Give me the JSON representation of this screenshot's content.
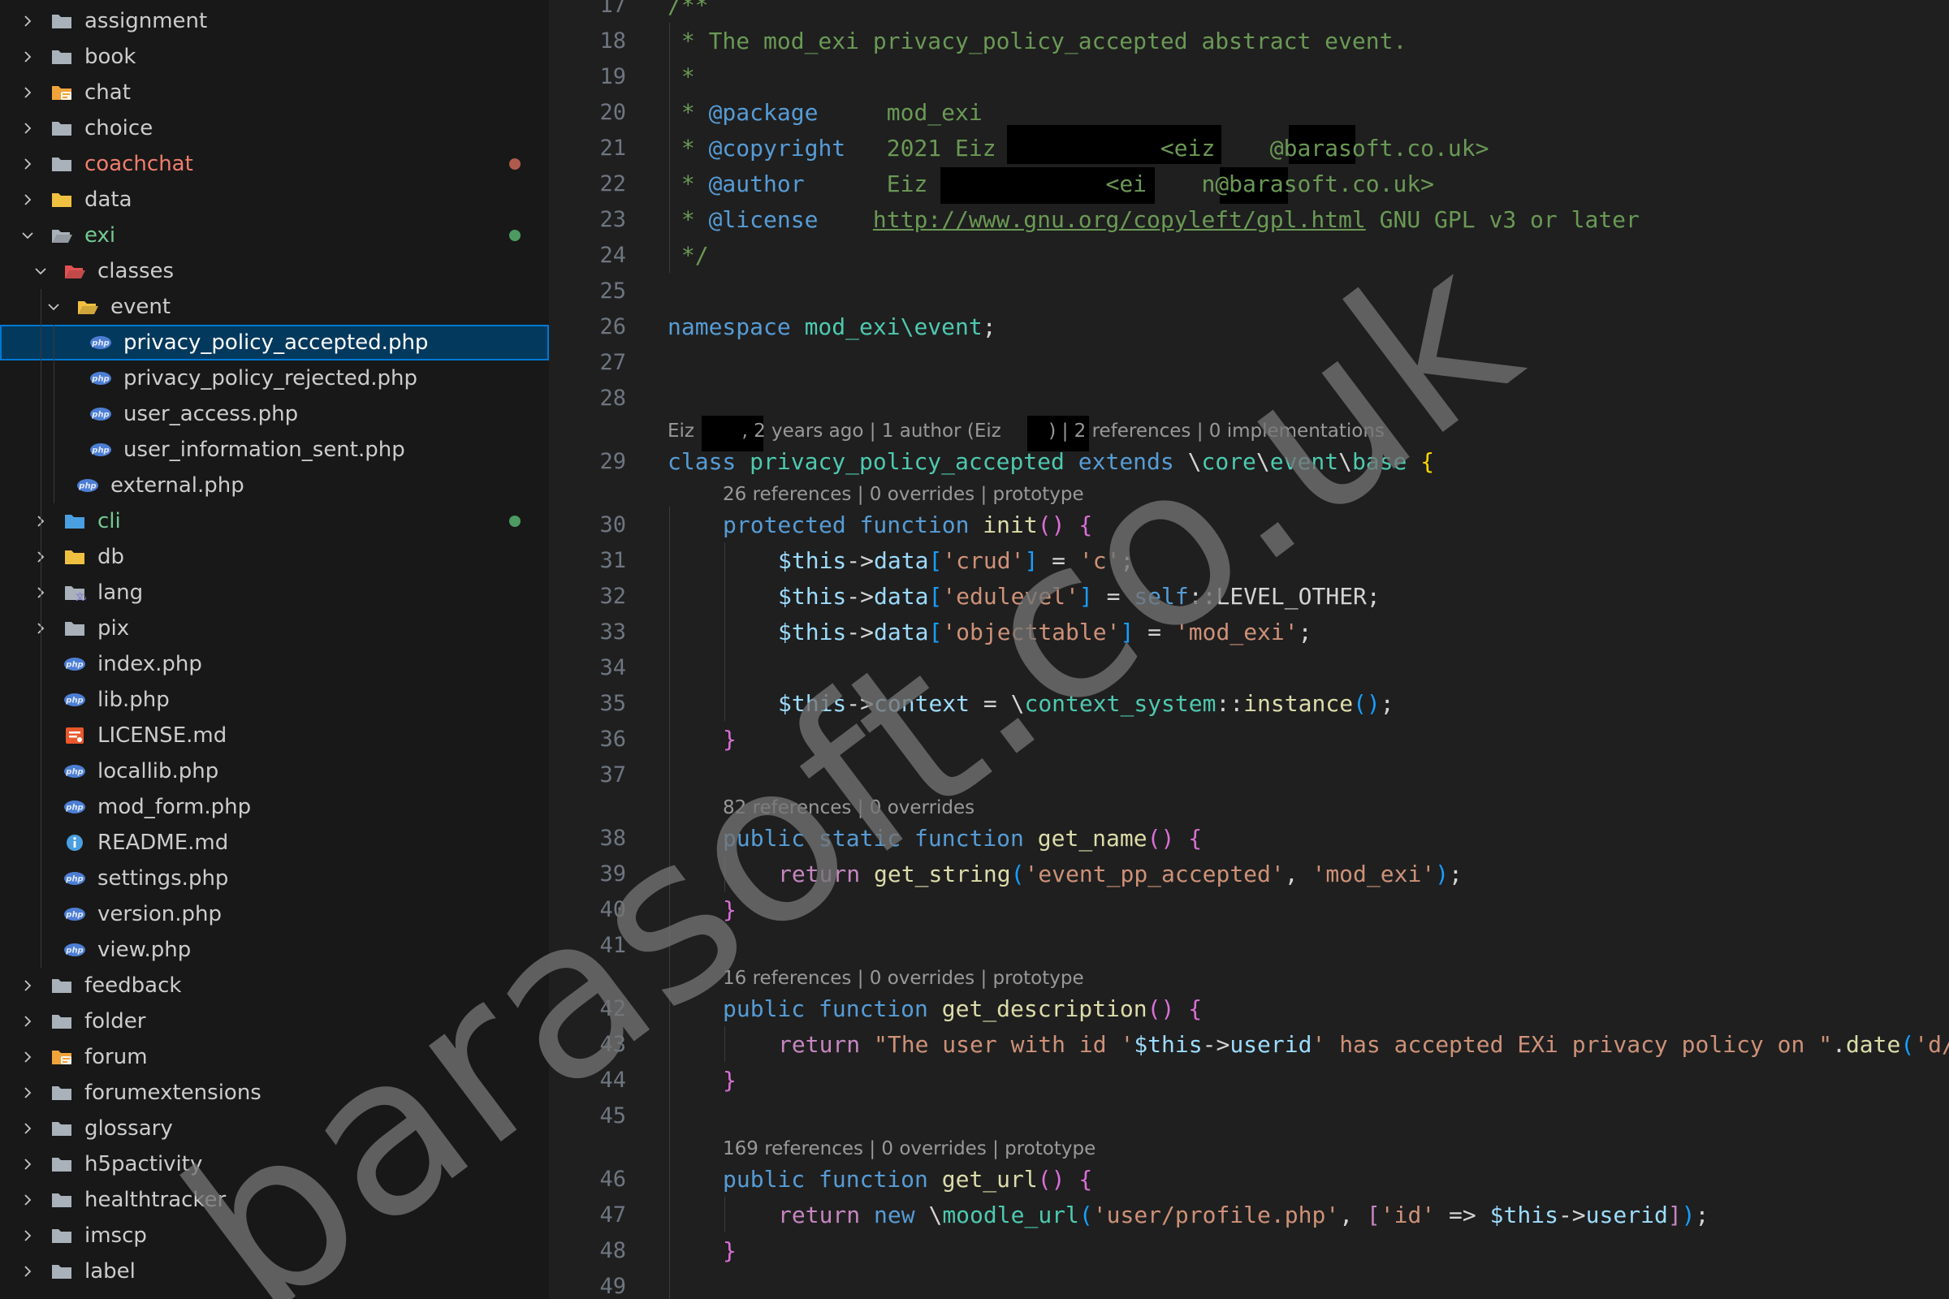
{
  "explorer": {
    "items": [
      {
        "label": "assignment",
        "kind": "folder",
        "expanded": false,
        "depth": 0,
        "folder_color": "#a9b1ba"
      },
      {
        "label": "book",
        "kind": "folder",
        "expanded": false,
        "depth": 0,
        "folder_color": "#a9b1ba"
      },
      {
        "label": "chat",
        "kind": "folder-chat",
        "expanded": false,
        "depth": 0,
        "folder_color": "#f0a33a"
      },
      {
        "label": "choice",
        "kind": "folder",
        "expanded": false,
        "depth": 0,
        "folder_color": "#a9b1ba"
      },
      {
        "label": "coachchat",
        "kind": "folder",
        "expanded": false,
        "depth": 0,
        "folder_color": "#a9b1ba",
        "status": "modified"
      },
      {
        "label": "data",
        "kind": "folder",
        "expanded": false,
        "depth": 0,
        "folder_color": "#f0c040"
      },
      {
        "label": "exi",
        "kind": "folder-open",
        "expanded": true,
        "depth": 0,
        "folder_color": "#a9b1ba",
        "status": "added"
      },
      {
        "label": "classes",
        "kind": "folder-open",
        "expanded": true,
        "depth": 1,
        "folder_color": "#e05252"
      },
      {
        "label": "event",
        "kind": "folder-open",
        "expanded": true,
        "depth": 2,
        "folder_color": "#f0c040"
      },
      {
        "label": "privacy_policy_accepted.php",
        "kind": "php",
        "depth": 3,
        "selected": true
      },
      {
        "label": "privacy_policy_rejected.php",
        "kind": "php",
        "depth": 3
      },
      {
        "label": "user_access.php",
        "kind": "php",
        "depth": 3
      },
      {
        "label": "user_information_sent.php",
        "kind": "php",
        "depth": 3
      },
      {
        "label": "external.php",
        "kind": "php",
        "depth": 2
      },
      {
        "label": "cli",
        "kind": "folder",
        "expanded": false,
        "depth": 1,
        "folder_color": "#4a9fe0",
        "status": "added"
      },
      {
        "label": "db",
        "kind": "folder",
        "expanded": false,
        "depth": 1,
        "folder_color": "#f0c040"
      },
      {
        "label": "lang",
        "kind": "folder-lang",
        "expanded": false,
        "depth": 1,
        "folder_color": "#a9b1ba"
      },
      {
        "label": "pix",
        "kind": "folder",
        "expanded": false,
        "depth": 1,
        "folder_color": "#a9b1ba"
      },
      {
        "label": "index.php",
        "kind": "php",
        "depth": 1
      },
      {
        "label": "lib.php",
        "kind": "php",
        "depth": 1
      },
      {
        "label": "LICENSE.md",
        "kind": "license",
        "depth": 1
      },
      {
        "label": "locallib.php",
        "kind": "php",
        "depth": 1
      },
      {
        "label": "mod_form.php",
        "kind": "php",
        "depth": 1
      },
      {
        "label": "README.md",
        "kind": "info",
        "depth": 1
      },
      {
        "label": "settings.php",
        "kind": "php",
        "depth": 1
      },
      {
        "label": "version.php",
        "kind": "php",
        "depth": 1
      },
      {
        "label": "view.php",
        "kind": "php",
        "depth": 1
      },
      {
        "label": "feedback",
        "kind": "folder",
        "expanded": false,
        "depth": 0,
        "folder_color": "#a9b1ba"
      },
      {
        "label": "folder",
        "kind": "folder",
        "expanded": false,
        "depth": 0,
        "folder_color": "#a9b1ba"
      },
      {
        "label": "forum",
        "kind": "folder-chat",
        "expanded": false,
        "depth": 0,
        "folder_color": "#f0a33a"
      },
      {
        "label": "forumextensions",
        "kind": "folder",
        "expanded": false,
        "depth": 0,
        "folder_color": "#a9b1ba"
      },
      {
        "label": "glossary",
        "kind": "folder",
        "expanded": false,
        "depth": 0,
        "folder_color": "#a9b1ba"
      },
      {
        "label": "h5pactivity",
        "kind": "folder",
        "expanded": false,
        "depth": 0,
        "folder_color": "#a9b1ba"
      },
      {
        "label": "healthtracker",
        "kind": "folder",
        "expanded": false,
        "depth": 0,
        "folder_color": "#a9b1ba"
      },
      {
        "label": "imscp",
        "kind": "folder",
        "expanded": false,
        "depth": 0,
        "folder_color": "#a9b1ba"
      },
      {
        "label": "label",
        "kind": "folder",
        "expanded": false,
        "depth": 0,
        "folder_color": "#a9b1ba"
      }
    ],
    "colors": {
      "modified": "#b05a4e",
      "added": "#4e9a63",
      "php_icon": "#4c7ed4"
    }
  },
  "editor": {
    "lines": [
      {
        "n": 17,
        "indent": 0,
        "tokens": [
          [
            "cm",
            "/**"
          ]
        ]
      },
      {
        "n": 18,
        "indent": 0,
        "tokens": [
          [
            "cm",
            " * The mod_exi privacy_policy_accepted abstract event."
          ]
        ]
      },
      {
        "n": 19,
        "indent": 0,
        "tokens": [
          [
            "cm",
            " *"
          ]
        ]
      },
      {
        "n": 20,
        "indent": 0,
        "tokens": [
          [
            "cm",
            " * "
          ],
          [
            "kw",
            "@package"
          ],
          [
            "cm",
            "     mod_exi"
          ]
        ]
      },
      {
        "n": 21,
        "indent": 0,
        "tokens": [
          [
            "cm",
            " * "
          ],
          [
            "kw",
            "@copyright"
          ],
          [
            "cm",
            "   2021 Eiz            <eiz    @barasoft.co.uk>"
          ]
        ]
      },
      {
        "n": 22,
        "indent": 0,
        "tokens": [
          [
            "cm",
            " * "
          ],
          [
            "kw",
            "@author"
          ],
          [
            "cm",
            "      Eiz             <ei    n@barasoft.co.uk>"
          ]
        ]
      },
      {
        "n": 23,
        "indent": 0,
        "tokens": [
          [
            "cm",
            " * "
          ],
          [
            "kw",
            "@license"
          ],
          [
            "cm",
            "    "
          ],
          [
            "link",
            "http://www.gnu.org/copyleft/gpl.html"
          ],
          [
            "cm",
            " GNU GPL v3 or later"
          ]
        ]
      },
      {
        "n": 24,
        "indent": 0,
        "tokens": [
          [
            "cm",
            " */"
          ]
        ]
      },
      {
        "n": 25,
        "indent": 0,
        "tokens": []
      },
      {
        "n": 26,
        "indent": 0,
        "tokens": [
          [
            "kw",
            "namespace"
          ],
          [
            "pl",
            " "
          ],
          [
            "cls",
            "mod_exi\\event"
          ],
          [
            "pl",
            ";"
          ]
        ]
      },
      {
        "n": 27,
        "indent": 0,
        "tokens": []
      },
      {
        "n": 28,
        "indent": 0,
        "tokens": [],
        "lens": "Eiz        , 2 years ago | 1 author (Eiz        ) | 2 references | 0 implementations"
      },
      {
        "n": 29,
        "indent": 0,
        "tokens": [
          [
            "kw",
            "class"
          ],
          [
            "pl",
            " "
          ],
          [
            "cls",
            "privacy_policy_accepted"
          ],
          [
            "pl",
            " "
          ],
          [
            "kw",
            "extends"
          ],
          [
            "pl",
            " \\"
          ],
          [
            "cls",
            "core"
          ],
          [
            "pl",
            "\\"
          ],
          [
            "cls",
            "event"
          ],
          [
            "pl",
            "\\"
          ],
          [
            "cls",
            "base"
          ],
          [
            "pl",
            " "
          ],
          [
            "yb",
            "{"
          ]
        ],
        "lens": "26 references | 0 overrides | prototype"
      },
      {
        "n": 30,
        "indent": 1,
        "tokens": [
          [
            "kw",
            "protected"
          ],
          [
            "pl",
            " "
          ],
          [
            "kw",
            "function"
          ],
          [
            "pl",
            " "
          ],
          [
            "fn",
            "init"
          ],
          [
            "pb",
            "()"
          ],
          [
            "pl",
            " "
          ],
          [
            "pb",
            "{"
          ]
        ]
      },
      {
        "n": 31,
        "indent": 2,
        "tokens": [
          [
            "var",
            "$this"
          ],
          [
            "pl",
            "->"
          ],
          [
            "var",
            "data"
          ],
          [
            "bb",
            "["
          ],
          [
            "str",
            "'crud'"
          ],
          [
            "bb",
            "]"
          ],
          [
            "pl",
            " = "
          ],
          [
            "str",
            "'c'"
          ],
          [
            "pl",
            ";"
          ]
        ]
      },
      {
        "n": 32,
        "indent": 2,
        "tokens": [
          [
            "var",
            "$this"
          ],
          [
            "pl",
            "->"
          ],
          [
            "var",
            "data"
          ],
          [
            "bb",
            "["
          ],
          [
            "str",
            "'edulevel'"
          ],
          [
            "bb",
            "]"
          ],
          [
            "pl",
            " = "
          ],
          [
            "kw",
            "self"
          ],
          [
            "pl",
            "::LEVEL_OTHER;"
          ]
        ]
      },
      {
        "n": 33,
        "indent": 2,
        "tokens": [
          [
            "var",
            "$this"
          ],
          [
            "pl",
            "->"
          ],
          [
            "var",
            "data"
          ],
          [
            "bb",
            "["
          ],
          [
            "str",
            "'objecttable'"
          ],
          [
            "bb",
            "]"
          ],
          [
            "pl",
            " = "
          ],
          [
            "str",
            "'mod_exi'"
          ],
          [
            "pl",
            ";"
          ]
        ]
      },
      {
        "n": 34,
        "indent": 2,
        "tokens": []
      },
      {
        "n": 35,
        "indent": 2,
        "tokens": [
          [
            "var",
            "$this"
          ],
          [
            "pl",
            "->"
          ],
          [
            "var",
            "context"
          ],
          [
            "pl",
            " = \\"
          ],
          [
            "cls",
            "context_system"
          ],
          [
            "pl",
            "::"
          ],
          [
            "fn",
            "instance"
          ],
          [
            "bb",
            "()"
          ],
          [
            "pl",
            ";"
          ]
        ]
      },
      {
        "n": 36,
        "indent": 1,
        "tokens": [
          [
            "pb",
            "}"
          ]
        ]
      },
      {
        "n": 37,
        "indent": 1,
        "tokens": [],
        "lens": "82 references | 0 overrides"
      },
      {
        "n": 38,
        "indent": 1,
        "tokens": [
          [
            "kw",
            "public"
          ],
          [
            "pl",
            " "
          ],
          [
            "kw",
            "static"
          ],
          [
            "pl",
            " "
          ],
          [
            "kw",
            "function"
          ],
          [
            "pl",
            " "
          ],
          [
            "fn",
            "get_name"
          ],
          [
            "pb",
            "()"
          ],
          [
            "pl",
            " "
          ],
          [
            "pb",
            "{"
          ]
        ]
      },
      {
        "n": 39,
        "indent": 2,
        "tokens": [
          [
            "ctl",
            "return"
          ],
          [
            "pl",
            " "
          ],
          [
            "fn",
            "get_string"
          ],
          [
            "bb",
            "("
          ],
          [
            "str",
            "'event_pp_accepted'"
          ],
          [
            "pl",
            ", "
          ],
          [
            "str",
            "'mod_exi'"
          ],
          [
            "bb",
            ")"
          ],
          [
            "pl",
            ";"
          ]
        ]
      },
      {
        "n": 40,
        "indent": 1,
        "tokens": [
          [
            "pb",
            "}"
          ]
        ]
      },
      {
        "n": 41,
        "indent": 1,
        "tokens": [],
        "lens": "16 references | 0 overrides | prototype"
      },
      {
        "n": 42,
        "indent": 1,
        "tokens": [
          [
            "kw",
            "public"
          ],
          [
            "pl",
            " "
          ],
          [
            "kw",
            "function"
          ],
          [
            "pl",
            " "
          ],
          [
            "fn",
            "get_description"
          ],
          [
            "pb",
            "()"
          ],
          [
            "pl",
            " "
          ],
          [
            "pb",
            "{"
          ]
        ]
      },
      {
        "n": 43,
        "indent": 2,
        "tokens": [
          [
            "ctl",
            "return"
          ],
          [
            "pl",
            " "
          ],
          [
            "str",
            "\"The user with id '"
          ],
          [
            "var",
            "$this"
          ],
          [
            "pl",
            "->"
          ],
          [
            "var",
            "userid"
          ],
          [
            "str",
            "' has accepted EXi privacy policy on \""
          ],
          [
            "pl",
            "."
          ],
          [
            "fn",
            "date"
          ],
          [
            "bb",
            "("
          ],
          [
            "str",
            "'d/"
          ]
        ]
      },
      {
        "n": 44,
        "indent": 1,
        "tokens": [
          [
            "pb",
            "}"
          ]
        ]
      },
      {
        "n": 45,
        "indent": 1,
        "tokens": [],
        "lens": "169 references | 0 overrides | prototype"
      },
      {
        "n": 46,
        "indent": 1,
        "tokens": [
          [
            "kw",
            "public"
          ],
          [
            "pl",
            " "
          ],
          [
            "kw",
            "function"
          ],
          [
            "pl",
            " "
          ],
          [
            "fn",
            "get_url"
          ],
          [
            "pb",
            "()"
          ],
          [
            "pl",
            " "
          ],
          [
            "pb",
            "{"
          ]
        ]
      },
      {
        "n": 47,
        "indent": 2,
        "tokens": [
          [
            "ctl",
            "return"
          ],
          [
            "pl",
            " "
          ],
          [
            "kw",
            "new"
          ],
          [
            "pl",
            " \\"
          ],
          [
            "cls",
            "moodle_url"
          ],
          [
            "bb",
            "("
          ],
          [
            "str",
            "'user/profile.php'"
          ],
          [
            "pl",
            ", "
          ],
          [
            "ctl",
            "["
          ],
          [
            "str",
            "'id'"
          ],
          [
            "pl",
            " => "
          ],
          [
            "var",
            "$this"
          ],
          [
            "pl",
            "->"
          ],
          [
            "var",
            "userid"
          ],
          [
            "ctl",
            "]"
          ],
          [
            "bb",
            ")"
          ],
          [
            "pl",
            ";"
          ]
        ]
      },
      {
        "n": 48,
        "indent": 1,
        "tokens": [
          [
            "pb",
            "}"
          ]
        ]
      },
      {
        "n": 49,
        "indent": 1,
        "tokens": []
      }
    ]
  },
  "watermark": {
    "text": "barasoft.co.uk"
  }
}
